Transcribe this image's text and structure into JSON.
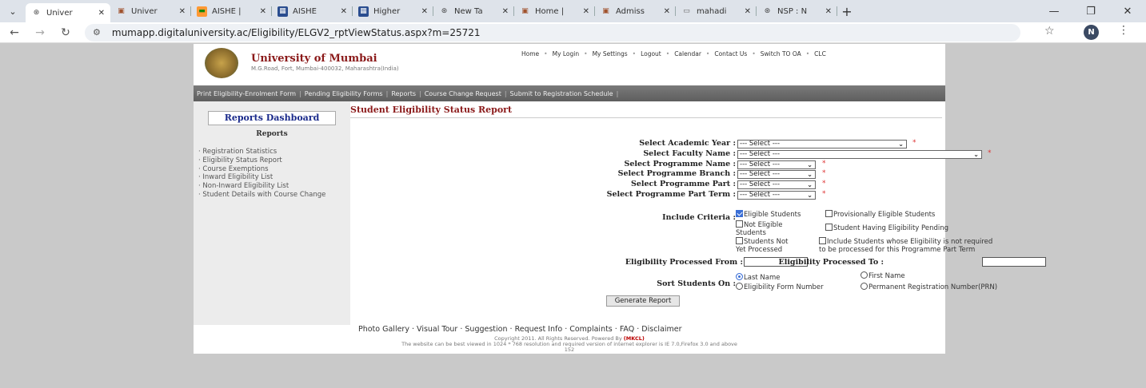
{
  "browser": {
    "tabs": [
      {
        "label": "Univer",
        "icon": "globe-icon",
        "active": true
      },
      {
        "label": "Univer",
        "icon": "university-icon"
      },
      {
        "label": "AISHE |",
        "icon": "india-flag-icon"
      },
      {
        "label": "AISHE",
        "icon": "aishe-icon"
      },
      {
        "label": "Higher",
        "icon": "aishe-icon"
      },
      {
        "label": "New Ta",
        "icon": "globe-icon"
      },
      {
        "label": "Home |",
        "icon": "university-icon"
      },
      {
        "label": "Admiss",
        "icon": "university-icon"
      },
      {
        "label": "mahadi",
        "icon": "document-icon"
      },
      {
        "label": "NSP : N",
        "icon": "globe-icon"
      }
    ],
    "url": "mumapp.digitaluniversity.ac/Eligibility/ELGV2_rptViewStatus.aspx?m=25721",
    "profile_initial": "N"
  },
  "header": {
    "university_name": "University of Mumbai",
    "address": "M.G.Road, Fort, Mumbai-400032, Maharashtra(India)",
    "top_nav": [
      "Home",
      "My Login",
      "My Settings",
      "Logout",
      "Calendar",
      "Contact Us",
      "Switch TO OA",
      "CLC"
    ]
  },
  "menubar": [
    "Print Eligibility-Enrolment Form",
    "Pending Eligibility Forms",
    "Reports",
    "Course Change Request",
    "Submit to Registration Schedule"
  ],
  "sidebar": {
    "dashboard": "Reports Dashboard",
    "heading": "Reports",
    "items": [
      "Registration Statistics",
      "Eligibility Status Report",
      "Course Exemptions",
      "Inward Eligibility List",
      "Non-Inward Eligibility List",
      "Student Details with Course Change"
    ]
  },
  "report": {
    "title": "Student Eligibility Status Report",
    "fields": {
      "academic_year": {
        "label": "Select Academic Year :",
        "value": "--- Select ---"
      },
      "faculty": {
        "label": "Select Faculty Name :",
        "value": "--- Select ---"
      },
      "programme": {
        "label": "Select Programme Name :",
        "value": "--- Select ---"
      },
      "branch": {
        "label": "Select Programme Branch :",
        "value": "--- Select ---"
      },
      "part": {
        "label": "Select Programme Part :",
        "value": "--- Select ---"
      },
      "part_term": {
        "label": "Select Programme Part Term :",
        "value": "--- Select ---"
      }
    },
    "required_marker": "*",
    "criteria_label": "Include Criteria :",
    "criteria": {
      "eligible": {
        "label": "Eligible Students",
        "checked": true
      },
      "provisional": {
        "label": "Provisionally Eligible Students",
        "checked": false
      },
      "not_eligible_1": "Not Eligible",
      "not_eligible_2": "Students",
      "pending": "Student Having Eligibility Pending",
      "not_processed_1": "Students Not",
      "not_processed_2": "Yet Processed",
      "not_required_1": "Include Students whose Eligibility is not required",
      "not_required_2": "to be processed for this Programme Part Term"
    },
    "processed_from": "Eligibility Processed From :",
    "processed_to": "Eligibility Processed To :",
    "sort_label": "Sort Students On :",
    "sort_options": {
      "last_name": {
        "label": "Last Name",
        "selected": true
      },
      "first_name": "First Name",
      "form_number": "Eligibility Form Number",
      "prn": "Permanent Registration Number(PRN)"
    },
    "generate_button": "Generate Report"
  },
  "footer": {
    "links": [
      "Photo Gallery",
      "Visual Tour",
      "Suggestion",
      "Request Info",
      "Complaints",
      "FAQ",
      "Disclaimer"
    ],
    "copyright": "Copyright 2011. All Rights Reserved. Powered By",
    "mkcl": "(MKCL)",
    "resolution_note": "The website can be best viewed in 1024 * 768 resolution and required version of internet explorer is IE 7.0,Firefox 3.0 and above",
    "page_number": "152"
  },
  "colors": {
    "accent": "#8b1a1a",
    "link_blue": "#1a2a8b",
    "checkbox": "#3b6fd6"
  }
}
